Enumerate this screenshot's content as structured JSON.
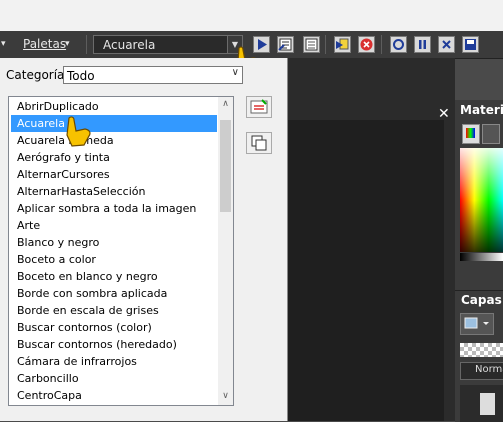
{
  "toolbar": {
    "menu_label": "Paletas",
    "combo_value": "Acuarela"
  },
  "popup": {
    "category_label": "Categoría:",
    "category_value": "Todo",
    "items": [
      "AbrirDuplicado",
      "Acuarela",
      "Acuarela húmeda",
      "Aerógrafo y tinta",
      "AlternarCursores",
      "AlternarHastaSelección",
      "Aplicar sombra a toda la imagen",
      "Arte",
      "Blanco y negro",
      "Boceto a color",
      "Boceto en blanco y negro",
      "Borde con sombra aplicada",
      "Borde en escala de grises",
      "Buscar contornos (color)",
      "Buscar contornos (heredado)",
      "Cámara de infrarrojos",
      "Carboncillo",
      "CentroCapa"
    ],
    "selected_index": 1
  },
  "panels": {
    "materials_title": "Materia",
    "layers_title": "Capas",
    "layers_blend": "Norma"
  },
  "colors": {
    "selection": "#3399ff",
    "toolbar_bg": "#3b3b3b",
    "canvas_dark": "#2b2b2b"
  }
}
